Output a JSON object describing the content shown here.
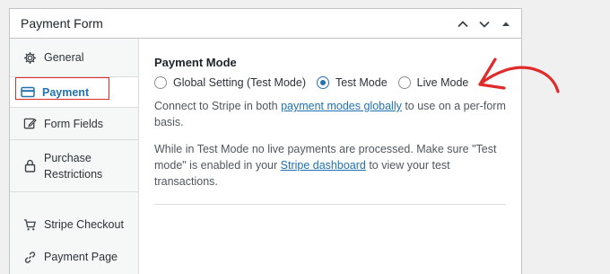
{
  "panel": {
    "title": "Payment Form"
  },
  "sidebar": {
    "items": [
      {
        "label": "General",
        "icon": "gear-icon"
      },
      {
        "label": "Payment",
        "icon": "credit-card-icon",
        "active": true
      },
      {
        "label": "Form Fields",
        "icon": "edit-icon"
      },
      {
        "label": "Purchase\nRestrictions",
        "icon": "lock-icon"
      },
      {
        "label": "Stripe Checkout",
        "icon": "cart-icon"
      },
      {
        "label": "Payment Page",
        "icon": "link-icon"
      }
    ]
  },
  "main": {
    "section_label": "Payment Mode",
    "options": [
      {
        "label": "Global Setting (Test Mode)",
        "checked": false
      },
      {
        "label": "Test Mode",
        "checked": true
      },
      {
        "label": "Live Mode",
        "checked": false
      }
    ],
    "desc1_pre": "Connect to Stripe in both ",
    "desc1_link": "payment modes globally",
    "desc1_post": " to use on a per-form basis.",
    "desc2_pre": "While in Test Mode no live payments are processed. Make sure \"Test mode\" is enabled in your ",
    "desc2_link": "Stripe dashboard",
    "desc2_post": " to view your test transactions."
  },
  "colors": {
    "accent": "#2271b1",
    "highlight": "#e02b2b"
  }
}
